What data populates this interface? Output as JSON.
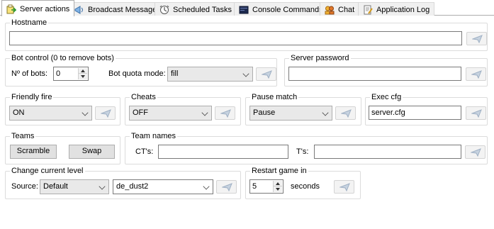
{
  "tabs": [
    {
      "label": "Server actions",
      "icon": "server-actions-icon"
    },
    {
      "label": "Broadcast Message",
      "icon": "broadcast-icon"
    },
    {
      "label": "Scheduled Tasks",
      "icon": "scheduled-tasks-icon"
    },
    {
      "label": "Console Commands",
      "icon": "console-icon"
    },
    {
      "label": "Chat",
      "icon": "chat-icon"
    },
    {
      "label": "Application Log",
      "icon": "log-icon"
    }
  ],
  "hostname": {
    "title": "Hostname",
    "value": ""
  },
  "bot_control": {
    "title": "Bot control (0 to remove bots)",
    "num_label": "Nº of bots:",
    "num_value": "0",
    "quota_label": "Bot quota mode:",
    "quota_value": "fill"
  },
  "server_password": {
    "title": "Server password",
    "value": ""
  },
  "friendly_fire": {
    "title": "Friendly fire",
    "value": "ON"
  },
  "cheats": {
    "title": "Cheats",
    "value": "OFF"
  },
  "pause_match": {
    "title": "Pause match",
    "value": "Pause"
  },
  "exec_cfg": {
    "title": "Exec cfg",
    "value": "server.cfg"
  },
  "teams": {
    "title": "Teams",
    "scramble": "Scramble",
    "swap": "Swap"
  },
  "team_names": {
    "title": "Team names",
    "ct_label": "CT's:",
    "ct_value": "",
    "t_label": "T's:",
    "t_value": ""
  },
  "change_level": {
    "title": "Change current level",
    "source_label": "Source:",
    "source_value": "Default",
    "map_value": "de_dust2"
  },
  "restart": {
    "title": "Restart game in",
    "value": "5",
    "unit": "seconds"
  },
  "colors": {
    "tab_border": "#adadad",
    "group_border": "#dcdcdc",
    "send_arrow": "#c3cfdc"
  }
}
